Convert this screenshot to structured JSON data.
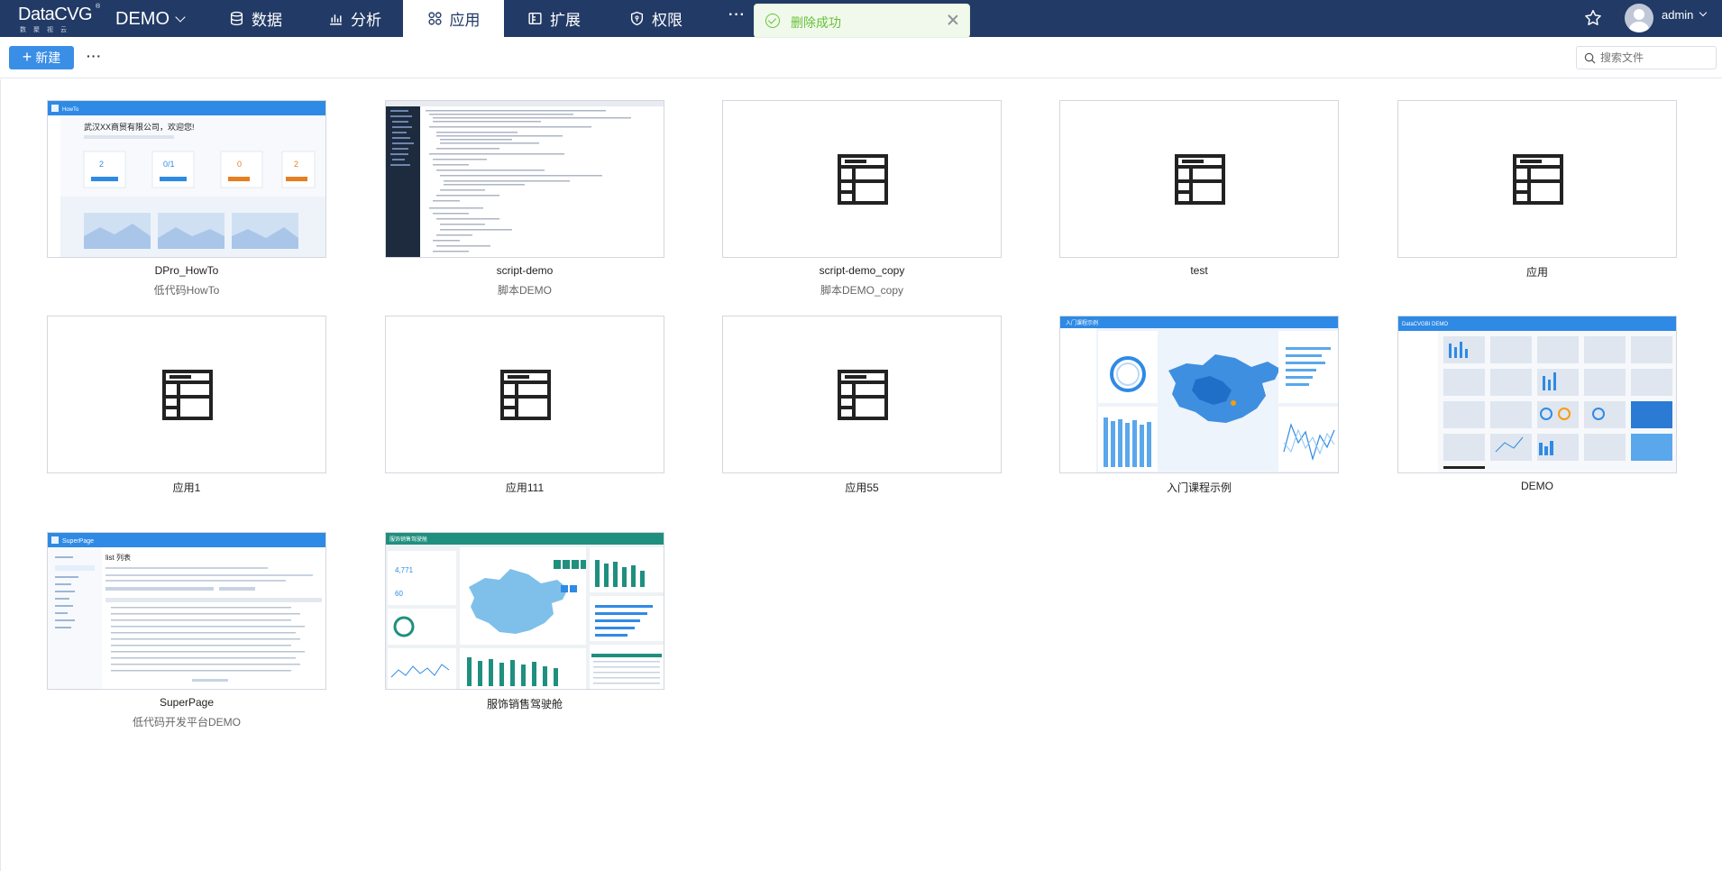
{
  "header": {
    "logo_text": "DataCVG",
    "logo_sub": "数聚视云",
    "logo_reg": "®",
    "project": "DEMO",
    "nav": [
      {
        "label": "数据",
        "icon": "database-icon"
      },
      {
        "label": "分析",
        "icon": "chart-icon"
      },
      {
        "label": "应用",
        "icon": "app-grid-icon",
        "active": true
      },
      {
        "label": "扩展",
        "icon": "extension-icon"
      },
      {
        "label": "权限",
        "icon": "shield-icon"
      }
    ],
    "more": "···",
    "toast": "删除成功",
    "user": "admin"
  },
  "toolbar": {
    "new_label": "新建",
    "more": "···",
    "search_placeholder": "搜索文件"
  },
  "apps": [
    {
      "name": "DPro_HowTo",
      "desc": "低代码HowTo",
      "thumb": "howto"
    },
    {
      "name": "script-demo",
      "desc": "脚本DEMO",
      "thumb": "code"
    },
    {
      "name": "script-demo_copy",
      "desc": "脚本DEMO_copy",
      "thumb": "icon"
    },
    {
      "name": "test",
      "desc": "",
      "thumb": "icon"
    },
    {
      "name": "应用",
      "desc": "",
      "thumb": "icon"
    },
    {
      "name": "应用1",
      "desc": "",
      "thumb": "icon"
    },
    {
      "name": "应用111",
      "desc": "",
      "thumb": "icon"
    },
    {
      "name": "应用55",
      "desc": "",
      "thumb": "icon"
    },
    {
      "name": "入门课程示例",
      "desc": "",
      "thumb": "map"
    },
    {
      "name": "DEMO",
      "desc": "",
      "thumb": "demo"
    },
    {
      "name": "SuperPage",
      "desc": "低代码开发平台DEMO",
      "thumb": "superpage"
    },
    {
      "name": "服饰销售驾驶舱",
      "desc": "",
      "thumb": "cockpit"
    }
  ],
  "thumb_text": {
    "howto_brand": "HowTo",
    "howto_title": "武汉XX商贸有限公司，欢迎您!",
    "howto_stats": [
      "2",
      "0/1",
      "0",
      "2"
    ],
    "map_brand": "入门课程示例",
    "demo_brand": "DataCVGBI DEMO",
    "sp_brand": "SuperPage",
    "sp_title": "list 列表",
    "cockpit_brand": "服饰销售驾驶舱",
    "cockpit_kpi": [
      "4,771",
      "60"
    ]
  },
  "colors": {
    "nav_bg": "#223a66",
    "primary": "#3a8ee6",
    "success": "#67c23a",
    "teal": "#1f8f7e"
  }
}
